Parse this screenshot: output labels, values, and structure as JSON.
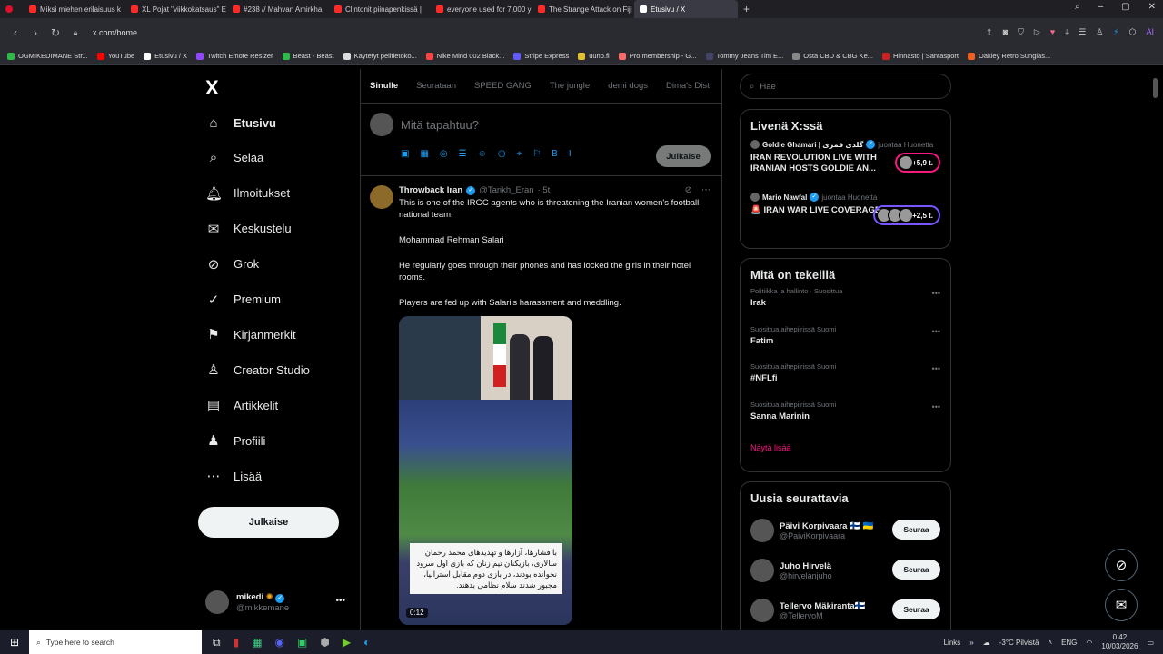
{
  "browser": {
    "tabs": [
      {
        "label": "Miksi miehen erilaisuus k",
        "color": "#ff2a2a"
      },
      {
        "label": "XL Pojat \"viikkokatsaus\" E",
        "color": "#ff2a2a"
      },
      {
        "label": "#238 // Mahvan Amirkha",
        "color": "#ff2a2a"
      },
      {
        "label": "Clintonit piinapenkissä |",
        "color": "#ff2a2a"
      },
      {
        "label": "everyone used for 7,000 y",
        "color": "#ff2a2a"
      },
      {
        "label": "The Strange Attack on Fiji",
        "color": "#ff2a2a"
      },
      {
        "label": "Etusivu / X",
        "color": "#ffffff"
      }
    ],
    "new_tab": "+",
    "url": "x.com/home",
    "bookmarks": [
      {
        "label": "OGMIKEDIMANE Str...",
        "color": "#2fb94a"
      },
      {
        "label": "YouTube",
        "color": "#ff0000"
      },
      {
        "label": "Etusivu / X",
        "color": "#ffffff"
      },
      {
        "label": "Twitch Emote Resizer",
        "color": "#9146ff"
      },
      {
        "label": "Beast - Beast",
        "color": "#2fb94a"
      },
      {
        "label": "Käytetyt pelitietoko...",
        "color": "#dddddd"
      },
      {
        "label": "Nike Mind 002 Black...",
        "color": "#ff4444"
      },
      {
        "label": "Stripe Express",
        "color": "#635bff"
      },
      {
        "label": "uuno.fi",
        "color": "#e0c030"
      },
      {
        "label": "Pro membership - G...",
        "color": "#ff6a6a"
      },
      {
        "label": "Tommy Jeans Tim E...",
        "color": "#444466"
      },
      {
        "label": "Osta CBD & CBG Ke...",
        "color": "#888888"
      },
      {
        "label": "Hinnasto | Santasport",
        "color": "#d02020"
      },
      {
        "label": "Oakley Retro Sunglas...",
        "color": "#f06020"
      }
    ]
  },
  "nav": {
    "logo": "X",
    "items": [
      {
        "label": "Etusivu",
        "icon": "home-icon",
        "glyph": "⌂"
      },
      {
        "label": "Selaa",
        "icon": "search-icon",
        "glyph": "⌕"
      },
      {
        "label": "Ilmoitukset",
        "icon": "bell-icon",
        "glyph": "🔔︎"
      },
      {
        "label": "Keskustelu",
        "icon": "mail-icon",
        "glyph": "✉"
      },
      {
        "label": "Grok",
        "icon": "grok-icon",
        "glyph": "⊘"
      },
      {
        "label": "Premium",
        "icon": "verified-icon",
        "glyph": "✓"
      },
      {
        "label": "Kirjanmerkit",
        "icon": "bookmark-icon",
        "glyph": "⚑"
      },
      {
        "label": "Creator Studio",
        "icon": "creator-icon",
        "glyph": "♙"
      },
      {
        "label": "Artikkelit",
        "icon": "article-icon",
        "glyph": "▤"
      },
      {
        "label": "Profiili",
        "icon": "profile-icon",
        "glyph": "♟"
      },
      {
        "label": "Lisää",
        "icon": "more-icon",
        "glyph": "⋯"
      }
    ],
    "post_button": "Julkaise",
    "profile": {
      "name": "mikedi",
      "handle": "@mikkemane"
    }
  },
  "timeline": {
    "tabs": [
      "Sinulle",
      "Seurataan",
      "SPEED GANG",
      "The jungle",
      "demi dogs",
      "Dima's Dist"
    ],
    "compose_placeholder": "Mitä tapahtuu?",
    "compose_icons": [
      "▣",
      "▦",
      "◎",
      "☰",
      "☺",
      "◷",
      "⌖",
      "⚐",
      "B",
      "I"
    ],
    "compose_button": "Julkaise",
    "tweet": {
      "name": "Throwback Iran",
      "handle": "@Tarikh_Eran",
      "time": "· 5t",
      "lines": [
        "This is one of the IRGC agents who is threatening the Iranian women's football national team.",
        "Mohammad Rehman Salari",
        "He regularly goes through their phones and has locked the girls in their hotel rooms.",
        "Players are fed up with Salari's harassment and meddling."
      ],
      "media_caption": "با فشارها، آزارها و تهدیدهای محمد رحمان سالاری، بازیکنان تیم زنان که بازی اول سرود نخوانده بودند، در بازی دوم مقابل استرالیا، مجبور شدند سلام نظامی بدهند.",
      "media_duration": "0:12"
    }
  },
  "sidebar": {
    "search_placeholder": "Hae",
    "live": {
      "title": "Livenä X:ssä",
      "items": [
        {
          "who": "Goldie Ghamari | گلدی قمری",
          "joins": "juontaa Huonetta",
          "title": "IRAN REVOLUTION LIVE WITH IRANIAN HOSTS GOLDIE AN...",
          "count": "+5,9 t.",
          "color": "#f91880"
        },
        {
          "who": "Mario Nawfal",
          "joins": "juontaa Huonetta",
          "title": "🚨 IRAN WAR LIVE COVERAGE",
          "count": "+2,5 t.",
          "color": "#7856ff"
        }
      ]
    },
    "trends": {
      "title": "Mitä on tekeillä",
      "items": [
        {
          "context": "Politiikka ja hallinto · Suosittua",
          "name": "Irak"
        },
        {
          "context": "Suosittua aihepiirissä Suomi",
          "name": "Fatim"
        },
        {
          "context": "Suosittua aihepiirissä Suomi",
          "name": "#NFLfi"
        },
        {
          "context": "Suosittua aihepiirissä Suomi",
          "name": "Sanna Marinin"
        }
      ],
      "show_more": "Näytä lisää"
    },
    "follow": {
      "title": "Uusia seurattavia",
      "items": [
        {
          "name": "Päivi Korpivaara 🇫🇮 🇺🇦",
          "handle": "@PaiviKorpivaara",
          "button": "Seuraa"
        },
        {
          "name": "Juho Hirvelä",
          "handle": "@hirvelanjuho",
          "button": "Seuraa"
        },
        {
          "name": "Tellervo Mäkiranta🇫🇮",
          "handle": "@TellervoM",
          "button": "Seuraa"
        }
      ]
    }
  },
  "taskbar": {
    "search_placeholder": "Type here to search",
    "links": "Links",
    "weather": "-3°C  Pilvistä",
    "lang": "ENG",
    "time": "0.42",
    "date": "10/03/2026"
  }
}
